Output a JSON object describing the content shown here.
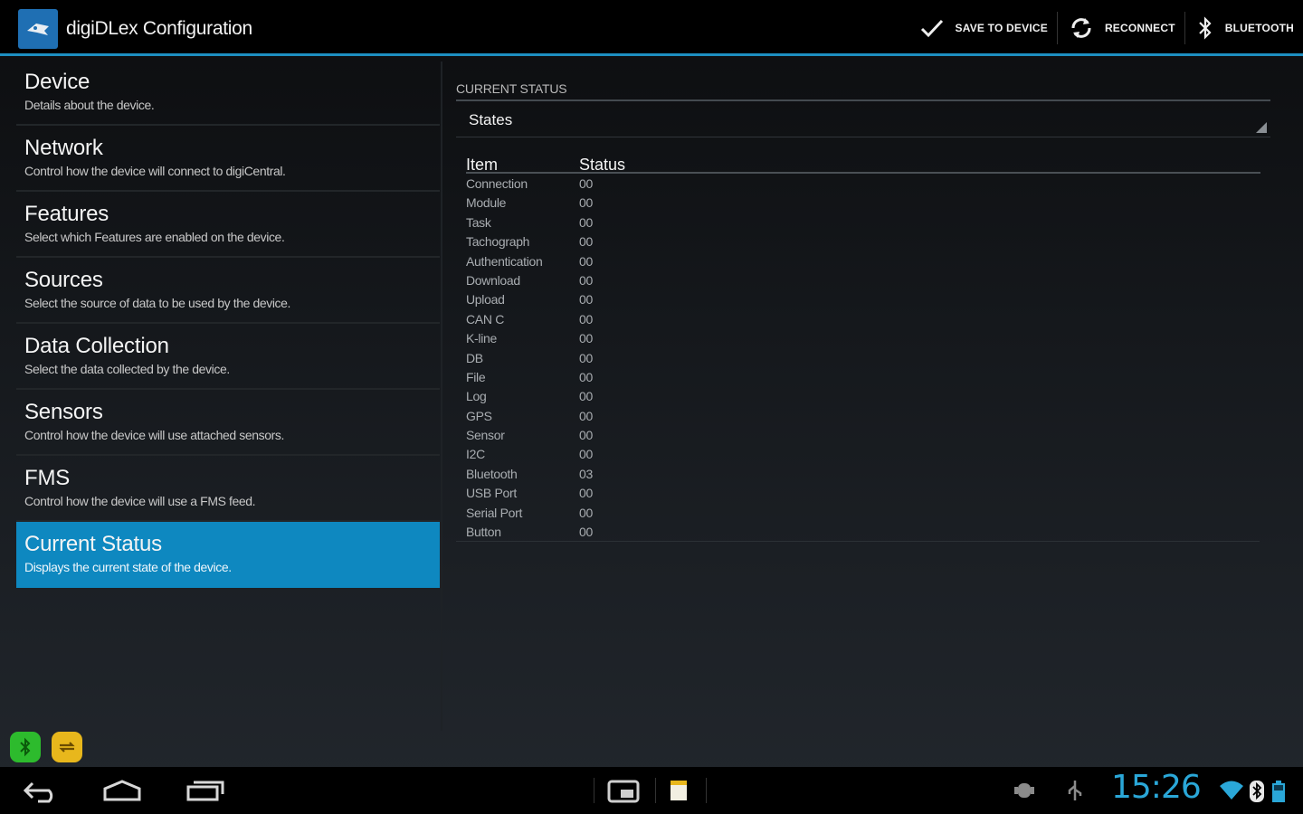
{
  "app": {
    "title": "digiDLex Configuration",
    "accent_color": "#0e88c0",
    "icon": "app-logo-icon"
  },
  "actions": [
    {
      "label": "SAVE TO DEVICE",
      "icon": "checkmark-icon"
    },
    {
      "label": "RECONNECT",
      "icon": "refresh-icon"
    },
    {
      "label": "BLUETOOTH",
      "icon": "bluetooth-icon"
    }
  ],
  "sidebar": {
    "items": [
      {
        "title": "Device",
        "subtitle": "Details about the device."
      },
      {
        "title": "Network",
        "subtitle": "Control how the device will connect to digiCentral."
      },
      {
        "title": "Features",
        "subtitle": "Select which Features are enabled on the device."
      },
      {
        "title": "Sources",
        "subtitle": "Select the source of data to be used by the device."
      },
      {
        "title": "Data Collection",
        "subtitle": "Select the data collected by the device."
      },
      {
        "title": "Sensors",
        "subtitle": "Control how the device will use attached sensors."
      },
      {
        "title": "FMS",
        "subtitle": "Control how the device will use a FMS feed."
      },
      {
        "title": "Current Status",
        "subtitle": "Displays the current state of the device.",
        "selected": true
      }
    ]
  },
  "main": {
    "section_header": "CURRENT STATUS",
    "spinner_value": "States",
    "table": {
      "headers": [
        "Item",
        "Status"
      ],
      "rows": [
        [
          "Connection",
          "00"
        ],
        [
          "Module",
          "00"
        ],
        [
          "Task",
          "00"
        ],
        [
          "Tachograph",
          "00"
        ],
        [
          "Authentication",
          "00"
        ],
        [
          "Download",
          "00"
        ],
        [
          "Upload",
          "00"
        ],
        [
          "CAN C",
          "00"
        ],
        [
          "K-line",
          "00"
        ],
        [
          "DB",
          "00"
        ],
        [
          "File",
          "00"
        ],
        [
          "Log",
          "00"
        ],
        [
          "GPS",
          "00"
        ],
        [
          "Sensor",
          "00"
        ],
        [
          "I2C",
          "00"
        ],
        [
          "Bluetooth",
          "03"
        ],
        [
          "USB Port",
          "00"
        ],
        [
          "Serial Port",
          "00"
        ],
        [
          "Button",
          "00"
        ]
      ]
    }
  },
  "notifications": [
    {
      "icon": "bluetooth-notification-icon",
      "color": "#2dbb2d"
    },
    {
      "icon": "sync-notification-icon",
      "color": "#e8b71c"
    }
  ],
  "system_bar": {
    "clock": "15:26",
    "clock_color": "#2aa7d8"
  }
}
